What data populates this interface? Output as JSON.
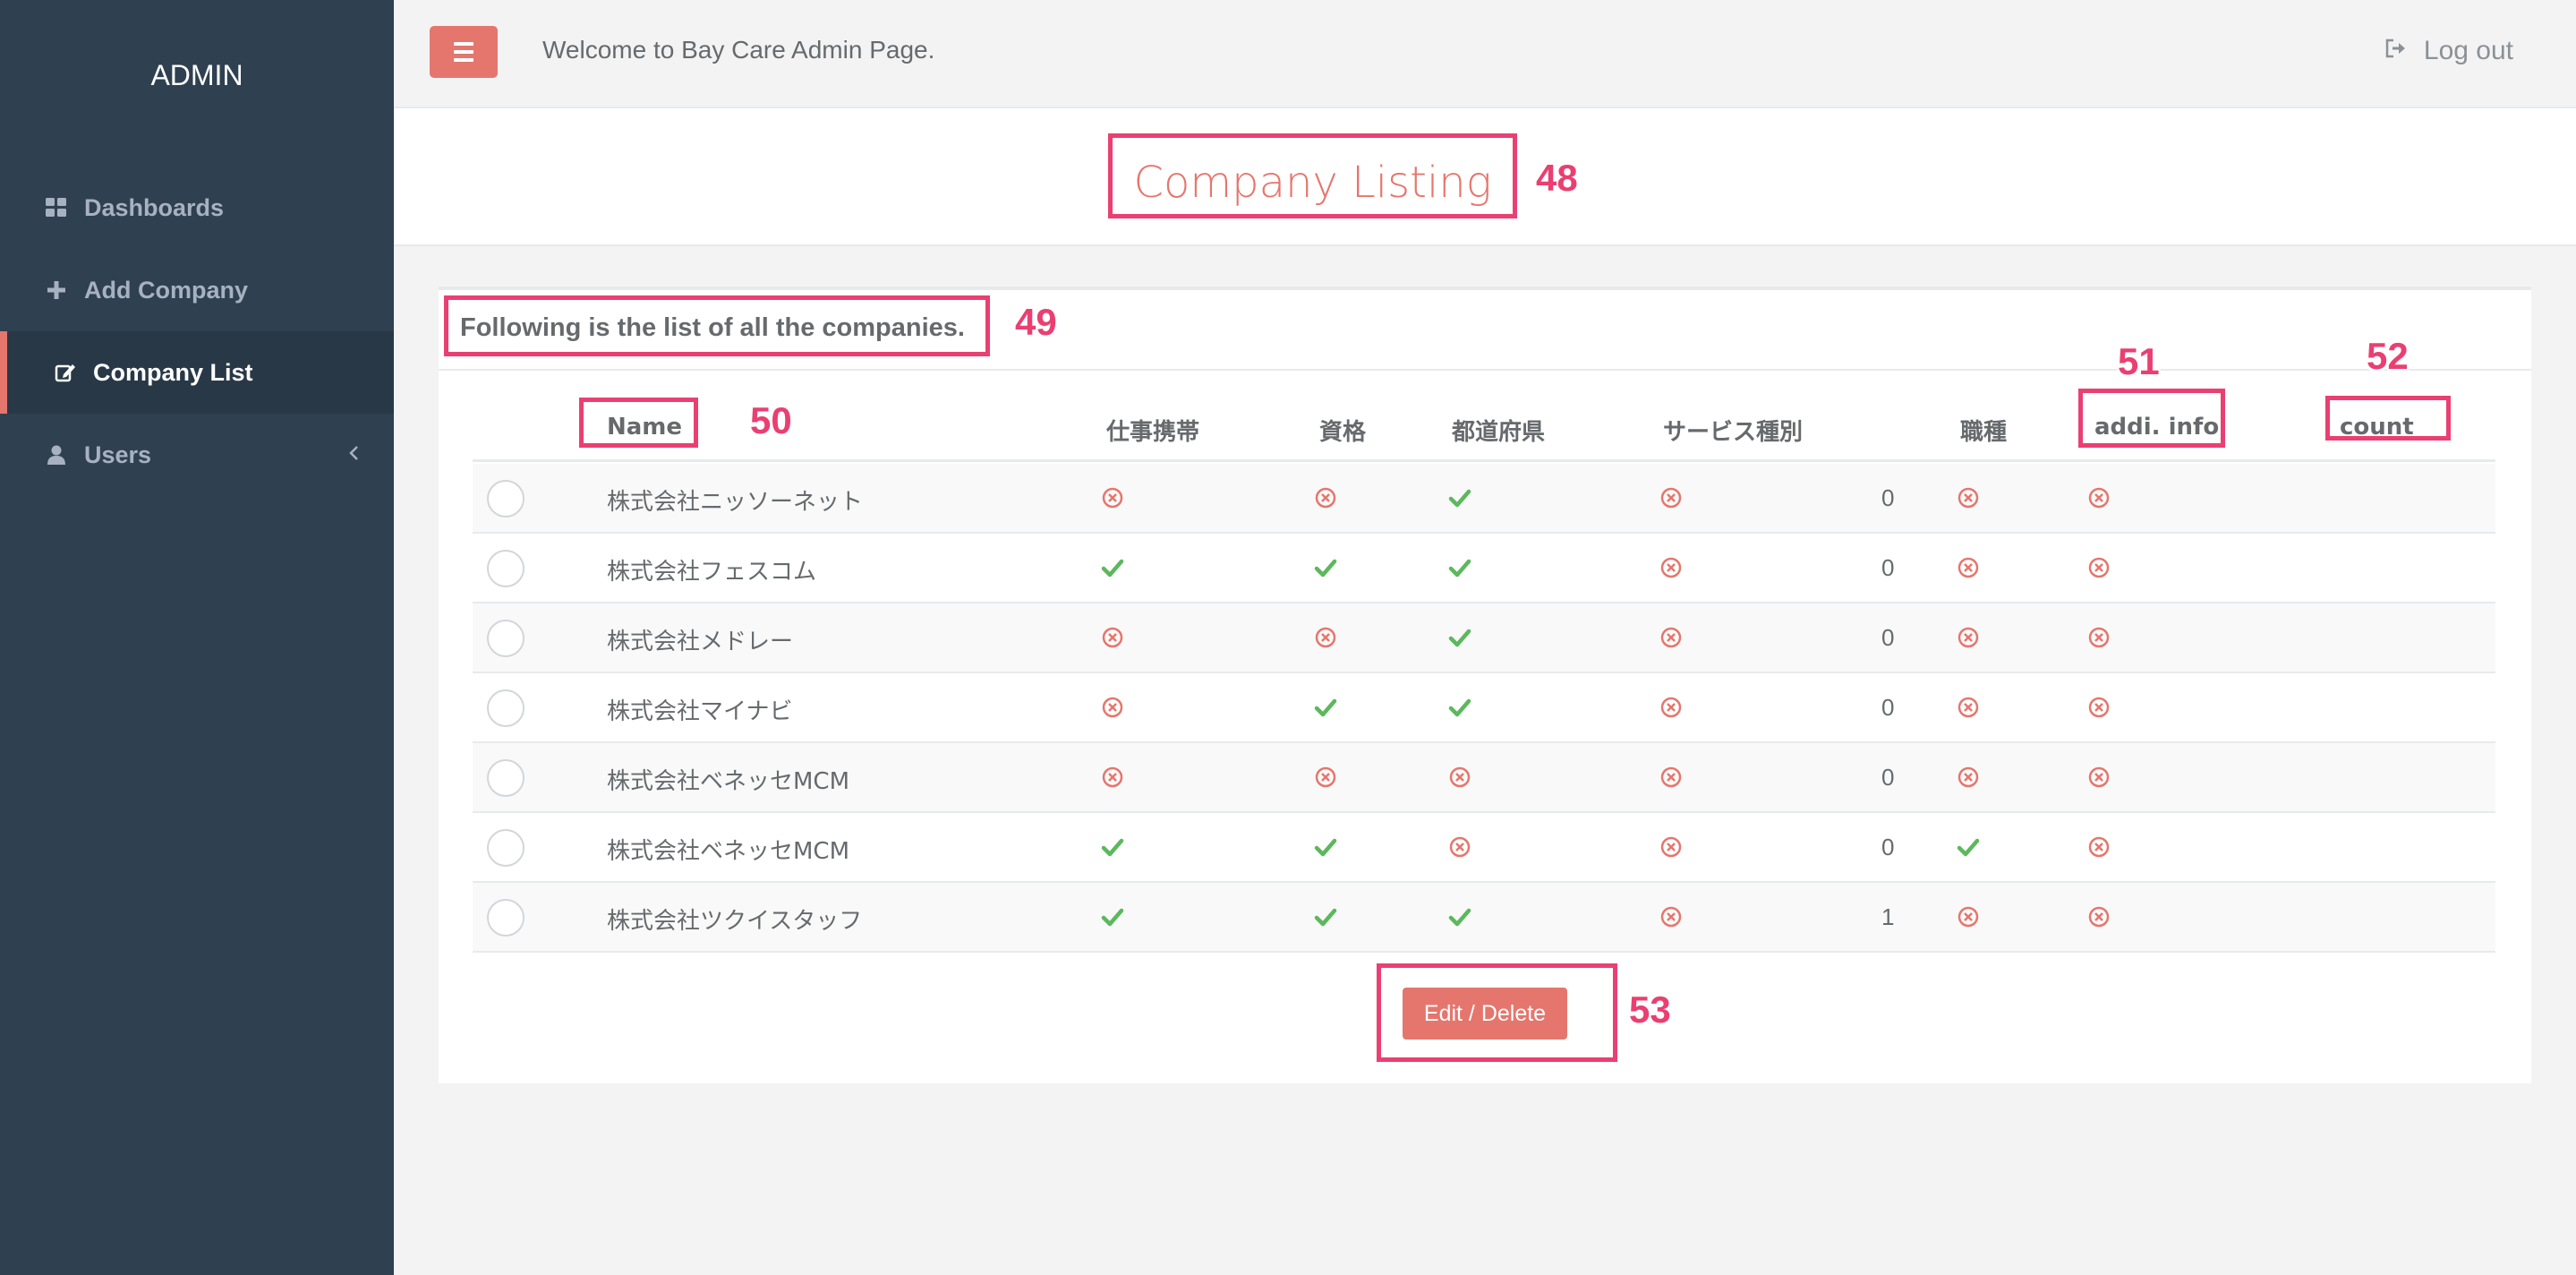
{
  "sidebar": {
    "brand": "ADMIN",
    "items": [
      {
        "label": "Dashboards",
        "icon": "grid-icon"
      },
      {
        "label": "Add Company",
        "icon": "plus-icon"
      },
      {
        "label": "Company List",
        "icon": "edit-icon",
        "active": true
      },
      {
        "label": "Users",
        "icon": "user-icon",
        "has_submenu": true
      }
    ]
  },
  "topbar": {
    "menu_icon": "hamburger-icon",
    "welcome": "Welcome to Bay Care Admin Page.",
    "logout_label": "Log out",
    "logout_icon": "sign-out-icon"
  },
  "page": {
    "title": "Company Listing"
  },
  "card": {
    "title": "Following is the list of all the companies."
  },
  "table": {
    "columns": [
      "Name",
      "仕事携帯",
      "資格",
      "都道府県",
      "サービス種別",
      "職種",
      "addi. info",
      "count"
    ],
    "rows": [
      {
        "name": "株式会社ニッソーネット",
        "flags": [
          false,
          false,
          true,
          false,
          false,
          false
        ],
        "count": "0"
      },
      {
        "name": "株式会社フェスコム",
        "flags": [
          true,
          true,
          true,
          false,
          false,
          false
        ],
        "count": "0"
      },
      {
        "name": "株式会社メドレー",
        "flags": [
          false,
          false,
          true,
          false,
          false,
          false
        ],
        "count": "0"
      },
      {
        "name": "株式会社マイナビ",
        "flags": [
          false,
          true,
          true,
          false,
          false,
          false
        ],
        "count": "0"
      },
      {
        "name": "株式会社ベネッセMCM",
        "flags": [
          false,
          false,
          false,
          false,
          false,
          false
        ],
        "count": "0"
      },
      {
        "name": "株式会社ベネッセMCM",
        "flags": [
          true,
          true,
          false,
          false,
          true,
          false
        ],
        "count": "0"
      },
      {
        "name": "株式会社ツクイスタッフ",
        "flags": [
          true,
          true,
          true,
          false,
          false,
          false
        ],
        "count": "1"
      }
    ]
  },
  "actions": {
    "edit_delete_label": "Edit / Delete"
  },
  "annotations": [
    "48",
    "49",
    "50",
    "51",
    "52",
    "53"
  ],
  "colors": {
    "sidebar_bg": "#2f4050",
    "accent": "#e5766d",
    "annotation": "#ea3f72",
    "check": "#5cb85c",
    "cross": "#e5766d"
  }
}
